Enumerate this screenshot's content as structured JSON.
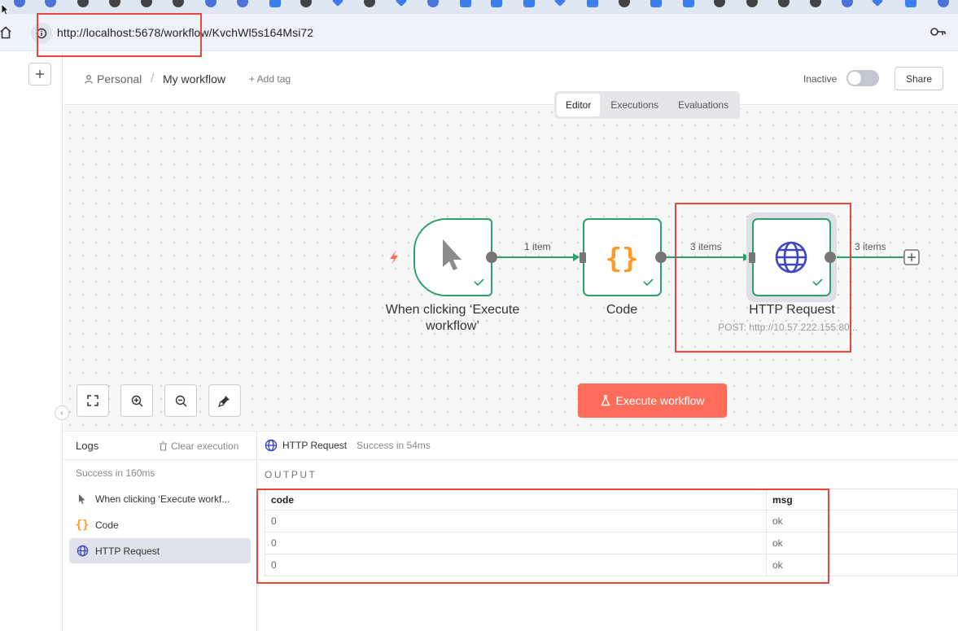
{
  "browser": {
    "url": "http://localhost:5678/workflow/KvchWl5s164Msi72"
  },
  "header": {
    "breadcrumb_project": "Personal",
    "breadcrumb_separator": "/",
    "workflow_name": "My workflow",
    "add_tag": "+ Add tag",
    "status_label": "Inactive",
    "active": false,
    "share_label": "Share"
  },
  "view_tabs": [
    {
      "label": "Editor",
      "active": true
    },
    {
      "label": "Executions",
      "active": false
    },
    {
      "label": "Evaluations",
      "active": false
    }
  ],
  "workflow": {
    "nodes": [
      {
        "title_line1": "When clicking ‘Execute",
        "title_line2": "workflow’",
        "icon": "cursor-icon"
      },
      {
        "title": "Code",
        "icon": "braces-icon"
      },
      {
        "title": "HTTP Request",
        "subtitle": "POST: http://10.57.222.155:80...",
        "icon": "globe-icon"
      }
    ],
    "edges": [
      {
        "label": "1 item"
      },
      {
        "label": "3 items"
      },
      {
        "label": "3 items"
      }
    ]
  },
  "execute_label": "Execute workflow",
  "logs": {
    "title": "Logs",
    "clear_label": "Clear execution",
    "status": "Success in 160ms",
    "items": [
      {
        "label": "When clicking ‘Execute workf...",
        "icon": "cursor-icon"
      },
      {
        "label": "Code",
        "icon": "braces-icon"
      },
      {
        "label": "HTTP Request",
        "icon": "globe-icon",
        "selected": true
      }
    ]
  },
  "output": {
    "node_name": "HTTP Request",
    "status": "Success in 54ms",
    "section_label": "OUTPUT",
    "columns": [
      "code",
      "msg"
    ],
    "rows": [
      [
        "0",
        "ok"
      ],
      [
        "0",
        "ok"
      ],
      [
        "0",
        "ok"
      ]
    ]
  },
  "colors": {
    "accent": "#ff6d5a",
    "success": "#29a36a",
    "braces": "#ff9b26",
    "globe": "#3b45c7",
    "highlight": "#e8473a"
  }
}
